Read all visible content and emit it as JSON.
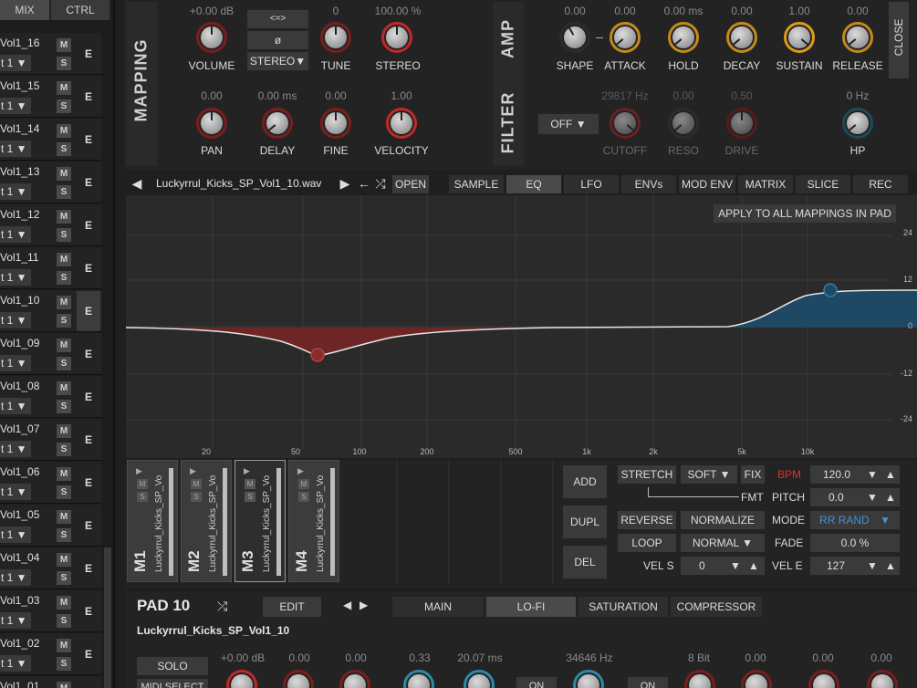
{
  "sidebar": {
    "tabs": [
      "MIX",
      "CTRL"
    ],
    "mute_label": "M",
    "solo_label": "S",
    "edit_label": "E",
    "items": [
      {
        "name": "Vol1_16",
        "channel": "t 1 ▼"
      },
      {
        "name": "Vol1_15",
        "channel": "t 1 ▼"
      },
      {
        "name": "Vol1_14",
        "channel": "t 1 ▼"
      },
      {
        "name": "Vol1_13",
        "channel": "t 1 ▼"
      },
      {
        "name": "Vol1_12",
        "channel": "t 1 ▼"
      },
      {
        "name": "Vol1_11",
        "channel": "t 1 ▼"
      },
      {
        "name": "Vol1_10",
        "channel": "t 1 ▼"
      },
      {
        "name": "Vol1_09",
        "channel": "t 1 ▼"
      },
      {
        "name": "Vol1_08",
        "channel": "t 1 ▼"
      },
      {
        "name": "Vol1_07",
        "channel": "t 1 ▼"
      },
      {
        "name": "Vol1_06",
        "channel": "t 1 ▼"
      },
      {
        "name": "Vol1_05",
        "channel": "t 1 ▼"
      },
      {
        "name": "Vol1_04",
        "channel": "t 1 ▼"
      },
      {
        "name": "Vol1_03",
        "channel": "t 1 ▼"
      },
      {
        "name": "Vol1_02",
        "channel": "t 1 ▼"
      },
      {
        "name": "Vol1_01",
        "channel": ""
      }
    ]
  },
  "mapping": {
    "section_label": "MAPPING",
    "volume": {
      "value": "+0.00 dB",
      "label": "VOLUME"
    },
    "tune": {
      "value": "0",
      "label": "TUNE"
    },
    "stereo": {
      "value": "100.00 %",
      "label": "STEREO"
    },
    "pan": {
      "value": "0.00",
      "label": "PAN"
    },
    "delay": {
      "value": "0.00 ms",
      "label": "DELAY"
    },
    "fine": {
      "value": "0.00",
      "label": "FINE"
    },
    "velocity": {
      "value": "1.00",
      "label": "VELOCITY"
    },
    "swap_btn": "<=>",
    "phase_btn": "ø",
    "stereo_mode": "STEREO▼"
  },
  "amp": {
    "section_label": "AMP",
    "shape": {
      "value": "0.00",
      "label": "SHAPE"
    },
    "attack": {
      "value": "0.00",
      "label": "ATTACK"
    },
    "hold": {
      "value": "0.00 ms",
      "label": "HOLD"
    },
    "decay": {
      "value": "0.00",
      "label": "DECAY"
    },
    "sustain": {
      "value": "1.00",
      "label": "SUSTAIN"
    },
    "release": {
      "value": "0.00",
      "label": "RELEASE"
    },
    "close_label": "CLOSE"
  },
  "filter": {
    "section_label": "FILTER",
    "mode": "OFF ▼",
    "cutoff": {
      "value": "29817 Hz",
      "label": "CUTOFF"
    },
    "reso": {
      "value": "0.00",
      "label": "RESO"
    },
    "drive": {
      "value": "0.50",
      "label": "DRIVE"
    },
    "hp": {
      "value": "0 Hz",
      "label": "HP"
    }
  },
  "filebar": {
    "prev": "◀",
    "filename": "Luckyrrul_Kicks_SP_Vol1_10.wav",
    "next": "▶",
    "back": "←",
    "shuffle": "⤮",
    "open": "OPEN"
  },
  "tabs": [
    "SAMPLE",
    "EQ",
    "LFO",
    "ENVs",
    "MOD ENV",
    "MATRIX",
    "SLICE",
    "REC"
  ],
  "eq": {
    "apply_label": "APPLY TO ALL MAPPINGS IN PAD",
    "db_labels": [
      "24",
      "12",
      "0",
      "-12",
      "-24"
    ],
    "freq_labels": [
      "20",
      "50",
      "100",
      "200",
      "500",
      "1k",
      "2k",
      "5k",
      "10k"
    ]
  },
  "mappings": {
    "cards": [
      {
        "title": "M1",
        "file": "Luckyrrul_Kicks_SP_Vo"
      },
      {
        "title": "M2",
        "file": "Luckyrrul_Kicks_SP_Vo"
      },
      {
        "title": "M3",
        "file": "Luckyrrul_Kicks_SP_Vo"
      },
      {
        "title": "M4",
        "file": "Luckyrrul_Kicks_SP_Vo"
      }
    ],
    "add": "ADD",
    "dupl": "DUPL",
    "del": "DEL",
    "stretch": "STRETCH",
    "soft": "SOFT ▼",
    "fix": "FIX",
    "fmt": "FMT",
    "bpm_label": "BPM",
    "bpm_value": "120.0",
    "pitch_label": "PITCH",
    "pitch_value": "0.0",
    "reverse": "REVERSE",
    "normalize": "NORMALIZE",
    "mode_label": "MODE",
    "mode_value": "RR RAND",
    "loop": "LOOP",
    "normal": "NORMAL ▼",
    "fade_label": "FADE",
    "fade_value": "0.0 %",
    "vels_label": "VEL S",
    "vels_value": "0",
    "vele_label": "VEL E",
    "vele_value": "127",
    "spin_down": "▼",
    "spin_up": "▲"
  },
  "pad": {
    "title": "PAD 10",
    "shuffle": "⤮",
    "edit": "EDIT",
    "nav_prev": "◀",
    "nav_next": "▶",
    "fx_tabs": [
      "MAIN",
      "LO-FI",
      "SATURATION",
      "COMPRESSOR"
    ],
    "sample_name": "Luckyrrul_Kicks_SP_Vol1_10",
    "solo": "SOLO",
    "midi_select": "MIDI SELECT",
    "on_label": "ON",
    "values": [
      "+0.00 dB",
      "0.00",
      "0.00",
      "0.33",
      "20.07 ms",
      "34646 Hz",
      "8 Bit",
      "0.00",
      "0.00",
      "0.00"
    ]
  },
  "colors": {
    "bpm_red": "#d9342b",
    "mode_blue": "#4a8fd0",
    "eq_cut": "#7a2424",
    "eq_boost": "#1d4a66"
  }
}
